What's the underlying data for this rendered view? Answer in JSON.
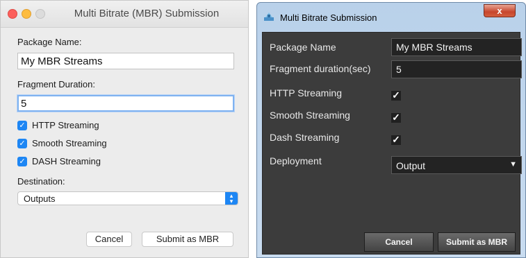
{
  "mac_dialog": {
    "title": "Multi Bitrate (MBR) Submission",
    "package_name_label": "Package Name:",
    "package_name_value": "My MBR Streams",
    "fragment_duration_label": "Fragment Duration:",
    "fragment_duration_value": "5",
    "checkboxes": [
      {
        "label": "HTTP Streaming",
        "checked": true
      },
      {
        "label": "Smooth Streaming",
        "checked": true
      },
      {
        "label": "DASH Streaming",
        "checked": true
      }
    ],
    "destination_label": "Destination:",
    "destination_value": "Outputs",
    "cancel_label": "Cancel",
    "submit_label": "Submit as MBR"
  },
  "win_dialog": {
    "title": "Multi Bitrate Submission",
    "close_glyph": "x",
    "package_name_label": "Package Name",
    "package_name_value": "My MBR Streams",
    "fragment_duration_label": "Fragment duration(sec)",
    "fragment_duration_value": "5",
    "checkboxes": [
      {
        "label": "HTTP Streaming",
        "checked": true
      },
      {
        "label": "Smooth Streaming",
        "checked": true
      },
      {
        "label": "Dash Streaming",
        "checked": true
      }
    ],
    "deployment_label": "Deployment",
    "deployment_value": "Output",
    "cancel_label": "Cancel",
    "submit_label": "Submit as MBR"
  },
  "icons": {
    "check": "✓",
    "select_arrows": "chevron-up-down-icon",
    "dropdown": "chevron-down-icon",
    "title_app": "app-icon"
  },
  "colors": {
    "mac_accent": "#1d86f4",
    "win_background": "#3c3c3c",
    "win_close": "#c7462c"
  }
}
